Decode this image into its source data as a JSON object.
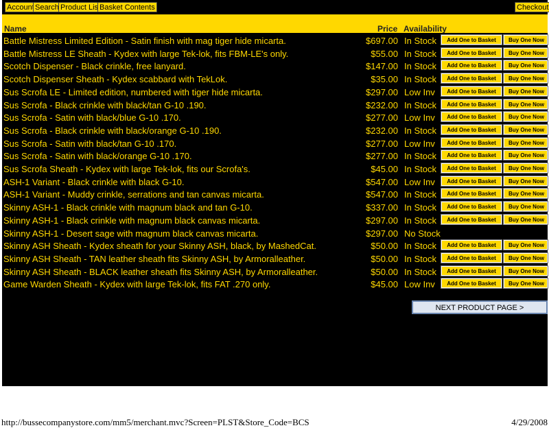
{
  "nav": {
    "account": "Account",
    "search": "Search",
    "product_list": "Product List",
    "basket_contents": "Basket Contents",
    "checkout": "Checkout"
  },
  "table": {
    "header_name": "Name",
    "header_price": "Price",
    "header_availability": "Availability",
    "add_label": "Add One to Basket",
    "buy_label": "Buy One Now"
  },
  "products": [
    {
      "name": "Battle Mistress Limited Edition - Satin finish with mag tiger hide micarta.",
      "price": "$697.00",
      "availability": "In Stock"
    },
    {
      "name": "Battle Mistress LE Sheath - Kydex with large Tek-lok, fits FBM-LE's only.",
      "price": "$55.00",
      "availability": "In Stock"
    },
    {
      "name": "Scotch Dispenser - Black crinkle, free lanyard.",
      "price": "$147.00",
      "availability": "In Stock"
    },
    {
      "name": "Scotch Dispenser Sheath - Kydex scabbard with TekLok.",
      "price": "$35.00",
      "availability": "In Stock"
    },
    {
      "name": "Sus Scrofa LE - Limited edition, numbered with tiger hide micarta.",
      "price": "$297.00",
      "availability": "Low Inv"
    },
    {
      "name": "Sus Scrofa - Black crinkle with black/tan G-10 .190.",
      "price": "$232.00",
      "availability": "In Stock"
    },
    {
      "name": "Sus Scrofa - Satin with black/blue G-10 .170.",
      "price": "$277.00",
      "availability": "Low Inv"
    },
    {
      "name": "Sus Scrofa - Black crinkle with black/orange G-10 .190.",
      "price": "$232.00",
      "availability": "In Stock"
    },
    {
      "name": "Sus Scrofa - Satin with black/tan G-10 .170.",
      "price": "$277.00",
      "availability": "Low Inv"
    },
    {
      "name": "Sus Scrofa - Satin with black/orange G-10 .170.",
      "price": "$277.00",
      "availability": "In Stock"
    },
    {
      "name": "Sus Scrofa Sheath - Kydex with large Tek-lok, fits our Scrofa's.",
      "price": "$45.00",
      "availability": "In Stock"
    },
    {
      "name": "ASH-1 Variant - Black crinkle with black G-10.",
      "price": "$547.00",
      "availability": "Low Inv"
    },
    {
      "name": "ASH-1 Variant - Muddy crinkle, serrations and tan canvas micarta.",
      "price": "$547.00",
      "availability": "In Stock"
    },
    {
      "name": "Skinny ASH-1 - Black crinkle with magnum black and tan G-10.",
      "price": "$337.00",
      "availability": "In Stock"
    },
    {
      "name": "Skinny ASH-1 - Black crinkle with magnum black canvas micarta.",
      "price": "$297.00",
      "availability": "In Stock"
    },
    {
      "name": "Skinny ASH-1 - Desert sage with magnum black canvas micarta.",
      "price": "$297.00",
      "availability": "No Stock"
    },
    {
      "name": "Skinny ASH Sheath - Kydex sheath for your Skinny ASH, black, by MashedCat.",
      "price": "$50.00",
      "availability": "In Stock"
    },
    {
      "name": "Skinny ASH Sheath - TAN leather sheath fits Skinny ASH, by Armoralleather.",
      "price": "$50.00",
      "availability": "In Stock"
    },
    {
      "name": "Skinny ASH Sheath - BLACK leather sheath fits Skinny ASH, by Armoralleather.",
      "price": "$50.00",
      "availability": "In Stock"
    },
    {
      "name": "Game Warden Sheath - Kydex with large Tek-lok, fits FAT .270 only.",
      "price": "$45.00",
      "availability": "Low Inv"
    }
  ],
  "next_page_label": "NEXT PRODUCT PAGE >",
  "footer": {
    "url": "http://bussecompanystore.com/mm5/merchant.mvc?Screen=PLST&Store_Code=BCS",
    "date": "4/29/2008"
  },
  "colors": {
    "accent": "#ffd800",
    "background": "#000000"
  }
}
